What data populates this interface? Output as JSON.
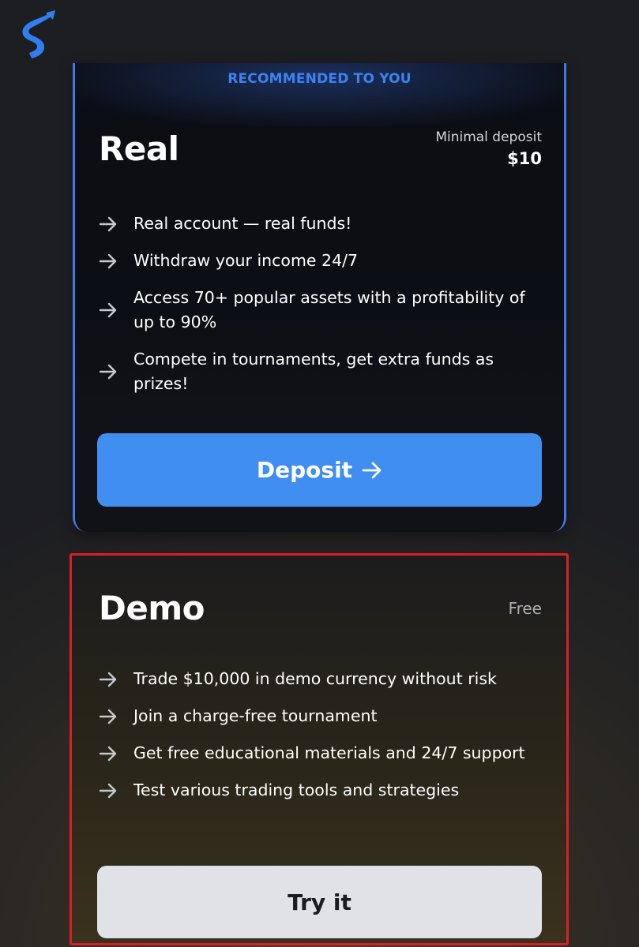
{
  "logo": {
    "icon": "brand-s-logo-icon",
    "color": "#2f7fee"
  },
  "real_card": {
    "banner": "RECOMMENDED TO YOU",
    "title": "Real",
    "deposit_label": "Minimal deposit",
    "deposit_value": "$10",
    "features": [
      "Real account — real funds!",
      "Withdraw your income 24/7",
      "Access 70+ popular assets with a profitability of up to 90%",
      "Compete in tournaments, get extra funds as prizes!"
    ],
    "button_label": "Deposit",
    "button_icon": "arrow-right-icon",
    "accent_color": "#3f8ef0"
  },
  "demo_card": {
    "title": "Demo",
    "price_label": "Free",
    "features": [
      "Trade $10,000 in demo currency without risk",
      "Join a charge-free tournament",
      "Get free educational materials and 24/7 support",
      "Test various trading tools and strategies"
    ],
    "button_label": "Try it",
    "highlight_color": "#d71f27"
  }
}
